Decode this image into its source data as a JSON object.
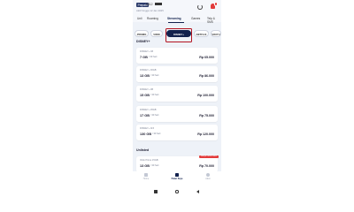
{
  "header": {
    "sim_badge": "Prepaid",
    "phone_number": "0812",
    "subtitle": "Aktif hingga 12 Jan 2025"
  },
  "top_tabs": [
    {
      "label": "Unli"
    },
    {
      "label": "Roaming"
    },
    {
      "label": "Streaming"
    },
    {
      "label": "Games"
    },
    {
      "label": "Telp & SMS"
    }
  ],
  "chips": [
    {
      "label": "PROMO"
    },
    {
      "label": "VIDIO"
    },
    {
      "label": "DISNEY+"
    },
    {
      "label": "NETFLIX"
    },
    {
      "label": "VIKIYU"
    }
  ],
  "section1_title": "DISNEY+",
  "packages": [
    {
      "name": "DISNEY+ 1B",
      "quota": "7 GB",
      "days": "/ 30 hari",
      "price": "Rp 65.000"
    },
    {
      "name": "DISNEY+ 30GB",
      "quota": "13 GB",
      "days": "/ 30 hari",
      "price": "Rp 86.000"
    },
    {
      "name": "DISNEY+ 2B",
      "quota": "15 GB",
      "days": "/ 30 hari",
      "price": "Rp 100.000"
    },
    {
      "name": "DISNEY+ 25GB",
      "quota": "17 GB",
      "days": "/ 30 hari",
      "price": "Rp 75.000"
    },
    {
      "name": "DISNEY+ 115",
      "quota": "130 GB",
      "days": "/ 30 hari",
      "price": "Rp 120.000"
    }
  ],
  "section2_title": "Unlisted",
  "unlisted_package": {
    "name": "Vidio Prime 15GB",
    "quota": "13 GB",
    "days": "/ 30 hari",
    "price": "Rp 70.000",
    "ribbon": "Hanya untuk kamu"
  },
  "bottom_nav": [
    {
      "label": "Home"
    },
    {
      "label": "Paket Saya"
    },
    {
      "label": "Akun"
    }
  ],
  "colors": {
    "accent": "#12214d",
    "highlight": "#b3121f",
    "alert": "#e23c3c"
  }
}
